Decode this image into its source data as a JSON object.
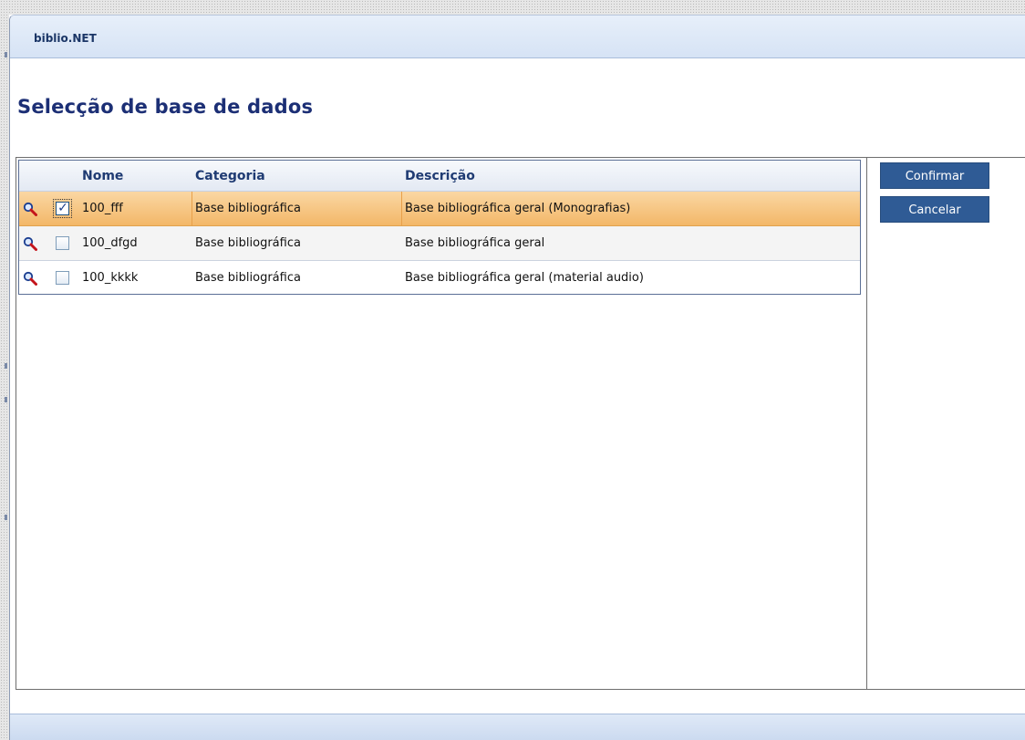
{
  "app": {
    "title": "biblio.NET"
  },
  "page": {
    "title": "Selecção de base de dados"
  },
  "table": {
    "columns": [
      "Nome",
      "Categoria",
      "Descrição"
    ],
    "rows": [
      {
        "name": "100_fff",
        "category": "Base bibliográfica",
        "description": "Base bibliográfica geral (Monografias)",
        "checked": true,
        "selected": true
      },
      {
        "name": "100_dfgd",
        "category": "Base bibliográfica",
        "description": "Base bibliográfica geral",
        "checked": false,
        "selected": false
      },
      {
        "name": "100_kkkk",
        "category": "Base bibliográfica",
        "description": "Base bibliográfica geral (material audio)",
        "checked": false,
        "selected": false
      }
    ]
  },
  "actions": {
    "confirm_label": "Confirmar",
    "cancel_label": "Cancelar"
  },
  "icons": {
    "row_search": "magnifier-icon",
    "check": "✓"
  },
  "colors": {
    "accent": "#2f5b95",
    "selected_row": "#f3b768",
    "title": "#1c2f75"
  }
}
